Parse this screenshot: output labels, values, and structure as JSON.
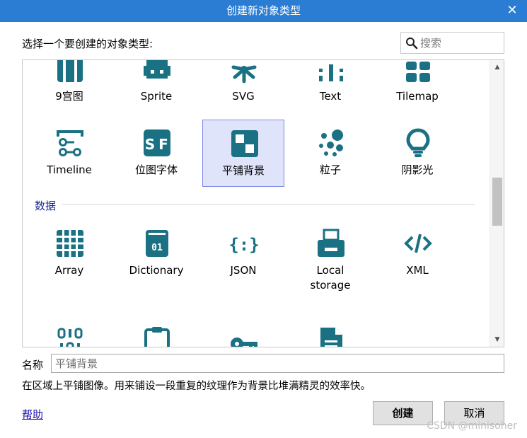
{
  "dialog": {
    "title": "创建新对象类型",
    "prompt": "选择一个要创建的对象类型:",
    "search_placeholder": "搜索",
    "section_data_label": "数据",
    "items_top": [
      {
        "label": "9宫图",
        "icon": "nine-patch-icon"
      },
      {
        "label": "Sprite",
        "icon": "sprite-icon"
      },
      {
        "label": "SVG",
        "icon": "svg-icon"
      },
      {
        "label": "Text",
        "icon": "text-icon"
      },
      {
        "label": "Tilemap",
        "icon": "tilemap-icon"
      }
    ],
    "items_row2": [
      {
        "label": "Timeline",
        "icon": "timeline-icon"
      },
      {
        "label": "位图字体",
        "icon": "sprite-font-icon"
      },
      {
        "label": "平铺背景",
        "icon": "tiled-background-icon"
      },
      {
        "label": "粒子",
        "icon": "particles-icon"
      },
      {
        "label": "阴影光",
        "icon": "shadow-light-icon"
      }
    ],
    "items_data": [
      {
        "label": "Array",
        "icon": "grid-icon"
      },
      {
        "label": "Dictionary",
        "icon": "book-icon"
      },
      {
        "label": "JSON",
        "icon": "json-icon"
      },
      {
        "label": "Local",
        "label2": "storage",
        "icon": "storage-icon"
      },
      {
        "label": "XML",
        "icon": "code-icon"
      }
    ],
    "selected_item": "平铺背景",
    "name_label": "名称",
    "name_value": "平铺背景",
    "description": "在区域上平铺图像。用来铺设一段重复的纹理作为背景比堆满精灵的效率快。",
    "help_label": "帮助",
    "create_label": "创建",
    "cancel_label": "取消",
    "watermark": "CSDN @minisoher"
  },
  "colors": {
    "titlebar": "#2b7cd3",
    "icon": "#1b7184",
    "selected_bg": "#dfe4fb",
    "selected_border": "#7b86e6",
    "section_label": "#1c2c92"
  }
}
